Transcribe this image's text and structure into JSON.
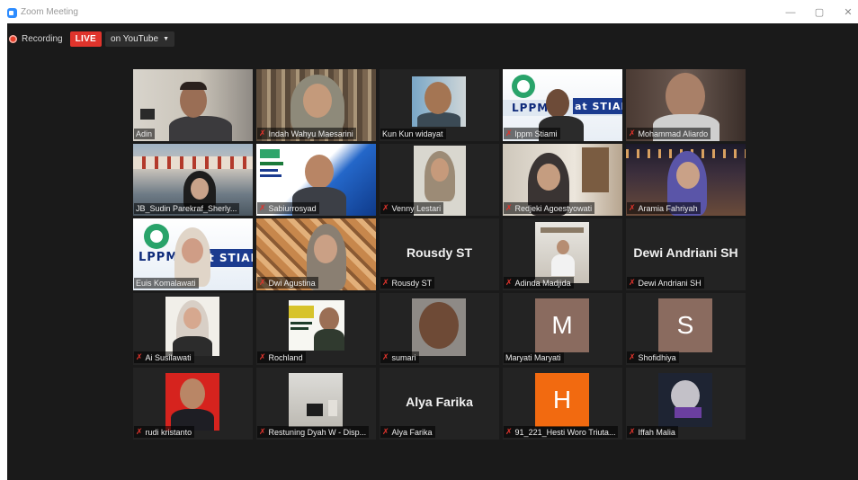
{
  "window": {
    "title": "Zoom Meeting",
    "minimize": "—",
    "maximize": "▢",
    "close": "✕"
  },
  "recording": {
    "label": "Recording",
    "live": "LIVE",
    "stream": "on YouTube"
  },
  "participants": [
    {
      "name": "Adin",
      "muted": false
    },
    {
      "name": "Indah Wahyu Maesarini",
      "muted": true
    },
    {
      "name": "Kun Kun widayat",
      "muted": false
    },
    {
      "name": "lppm Stiami",
      "muted": true,
      "banner": "LPPM",
      "banner2": "at STIAMI"
    },
    {
      "name": "Mohammad Aliardo",
      "muted": true
    },
    {
      "name": "JB_Sudin Parekraf_Sherly...",
      "muted": false
    },
    {
      "name": "Sabiurrosyad",
      "muted": true
    },
    {
      "name": "Venny Lestari",
      "muted": true
    },
    {
      "name": "Redjeki Agoestyowati",
      "muted": true
    },
    {
      "name": "Aramia Fahriyah",
      "muted": true
    },
    {
      "name": "Euis Komalawati",
      "muted": false,
      "active": true,
      "banner": "LPPM",
      "banner2": "t STIAMI"
    },
    {
      "name": "Dwi Agustina",
      "muted": true
    },
    {
      "name": "Rousdy ST",
      "muted": true,
      "display": "Rousdy ST"
    },
    {
      "name": "Adinda Madjida",
      "muted": true
    },
    {
      "name": "Dewi Andriani SH",
      "muted": true,
      "display": "Dewi Andriani SH"
    },
    {
      "name": "Ai Susilawati",
      "muted": true
    },
    {
      "name": "Rochland",
      "muted": true
    },
    {
      "name": "sumari",
      "muted": true
    },
    {
      "name": "Maryati Maryati",
      "muted": false,
      "letter": "M",
      "letter_color": "#8a6b5f"
    },
    {
      "name": "Shofidhiya",
      "muted": true,
      "letter": "S",
      "letter_color": "#8a6b5f"
    },
    {
      "name": "rudi kristanto",
      "muted": true
    },
    {
      "name": "Restuning Dyah W - Disp...",
      "muted": true
    },
    {
      "name": "Alya Farika",
      "muted": true,
      "display": "Alya Farika"
    },
    {
      "name": "91_221_Hesti Woro Triuta...",
      "muted": true,
      "letter": "H",
      "letter_color": "#f26a10"
    },
    {
      "name": "Iffah Malia",
      "muted": true
    }
  ]
}
